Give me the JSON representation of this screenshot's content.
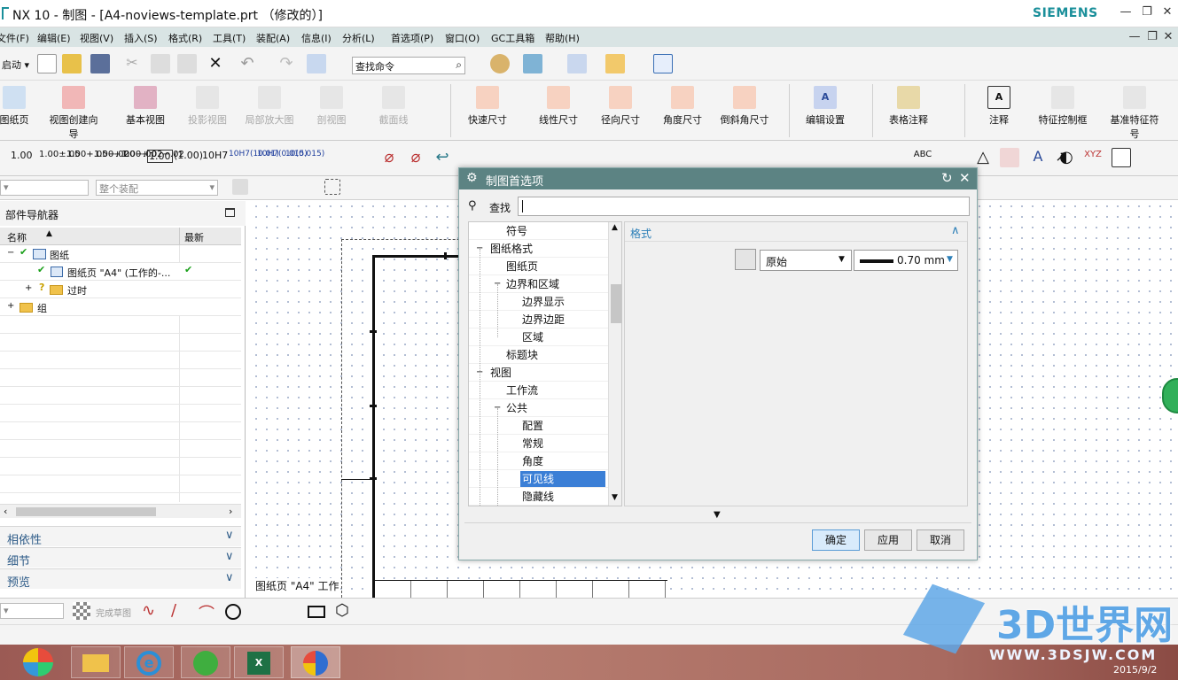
{
  "window": {
    "title": "NX 10 - 制图 - [A4-noviews-template.prt （修改的）]",
    "brand": "SIEMENS"
  },
  "menu": [
    "文件(F)",
    "编辑(E)",
    "视图(V)",
    "插入(S)",
    "格式(R)",
    "工具(T)",
    "装配(A)",
    "信息(I)",
    "分析(L)",
    "首选项(P)",
    "窗口(O)",
    "GC工具箱",
    "帮助(H)"
  ],
  "toolbar1": {
    "start_label": "启动",
    "search_placeholder": "查找命令"
  },
  "ribbon": {
    "new_sheet": "图纸页",
    "view_wizard": "视图创建向导",
    "base_view": "基本视图",
    "proj_view": "投影视图",
    "detail_view": "局部放大图",
    "section_view": "剖视图",
    "section_line": "截面线",
    "rapid_dim": "快速尺寸",
    "linear_dim": "线性尺寸",
    "radial_dim": "径向尺寸",
    "angular_dim": "角度尺寸",
    "chamfer_dim": "倒斜角尺寸",
    "edit_settings": "编辑设置",
    "table_note": "表格注释",
    "note": "注释",
    "fcf": "特征控制框",
    "datum": "基准特征符号"
  },
  "toolbar3": {
    "items": [
      "1.00",
      "1.00±.05",
      "1.00+.05−.02",
      "1.00+.00−.00",
      "1.00+.02−.02",
      "1.00",
      "(1.00)",
      "10H7",
      "10H7(10.01)",
      "10H7(0.015)",
      "10(0.015)"
    ]
  },
  "toolbar4": {
    "combo2": "整个装配"
  },
  "nav": {
    "title": "部件导航器",
    "col_name": "名称",
    "col_latest": "最新",
    "rows": [
      {
        "label": "图纸",
        "level": 0
      },
      {
        "label": "图纸页 \"A4\" (工作的-...",
        "level": 1
      },
      {
        "label": "过时",
        "level": 1
      },
      {
        "label": "组",
        "level": 0
      }
    ],
    "panels": [
      "相依性",
      "细节",
      "预览"
    ]
  },
  "canvas": {
    "sheet_label": "图纸页 \"A4\" 工作"
  },
  "dialog": {
    "title": "制图首选项",
    "find_label": "查找",
    "tree": [
      {
        "label": "符号",
        "level": 2
      },
      {
        "label": "图纸格式",
        "level": 1,
        "toggle": "−"
      },
      {
        "label": "图纸页",
        "level": 2
      },
      {
        "label": "边界和区域",
        "level": 2,
        "toggle": "−"
      },
      {
        "label": "边界显示",
        "level": 3
      },
      {
        "label": "边界边距",
        "level": 3
      },
      {
        "label": "区域",
        "level": 3
      },
      {
        "label": "标题块",
        "level": 2
      },
      {
        "label": "视图",
        "level": 1,
        "toggle": "−"
      },
      {
        "label": "工作流",
        "level": 2
      },
      {
        "label": "公共",
        "level": 2,
        "toggle": "−"
      },
      {
        "label": "配置",
        "level": 3
      },
      {
        "label": "常规",
        "level": 3
      },
      {
        "label": "角度",
        "level": 3
      },
      {
        "label": "可见线",
        "level": 3,
        "selected": true
      },
      {
        "label": "隐藏线",
        "level": 3
      }
    ],
    "section_title": "格式",
    "line_font": "原始",
    "line_width": "0.70 mm",
    "ok": "确定",
    "apply": "应用",
    "cancel": "取消"
  },
  "bottom": {
    "finish_sketch": "完成草图"
  },
  "taskbar": {
    "date": "2015/9/2"
  },
  "watermark": {
    "logo_text": "3D世界网",
    "url": "WWW.3DSJW.COM"
  },
  "colors": {
    "accent": "#5c8383",
    "select": "#3b7fd6",
    "link": "#2c5a87",
    "brand": "#1a8f9a"
  }
}
